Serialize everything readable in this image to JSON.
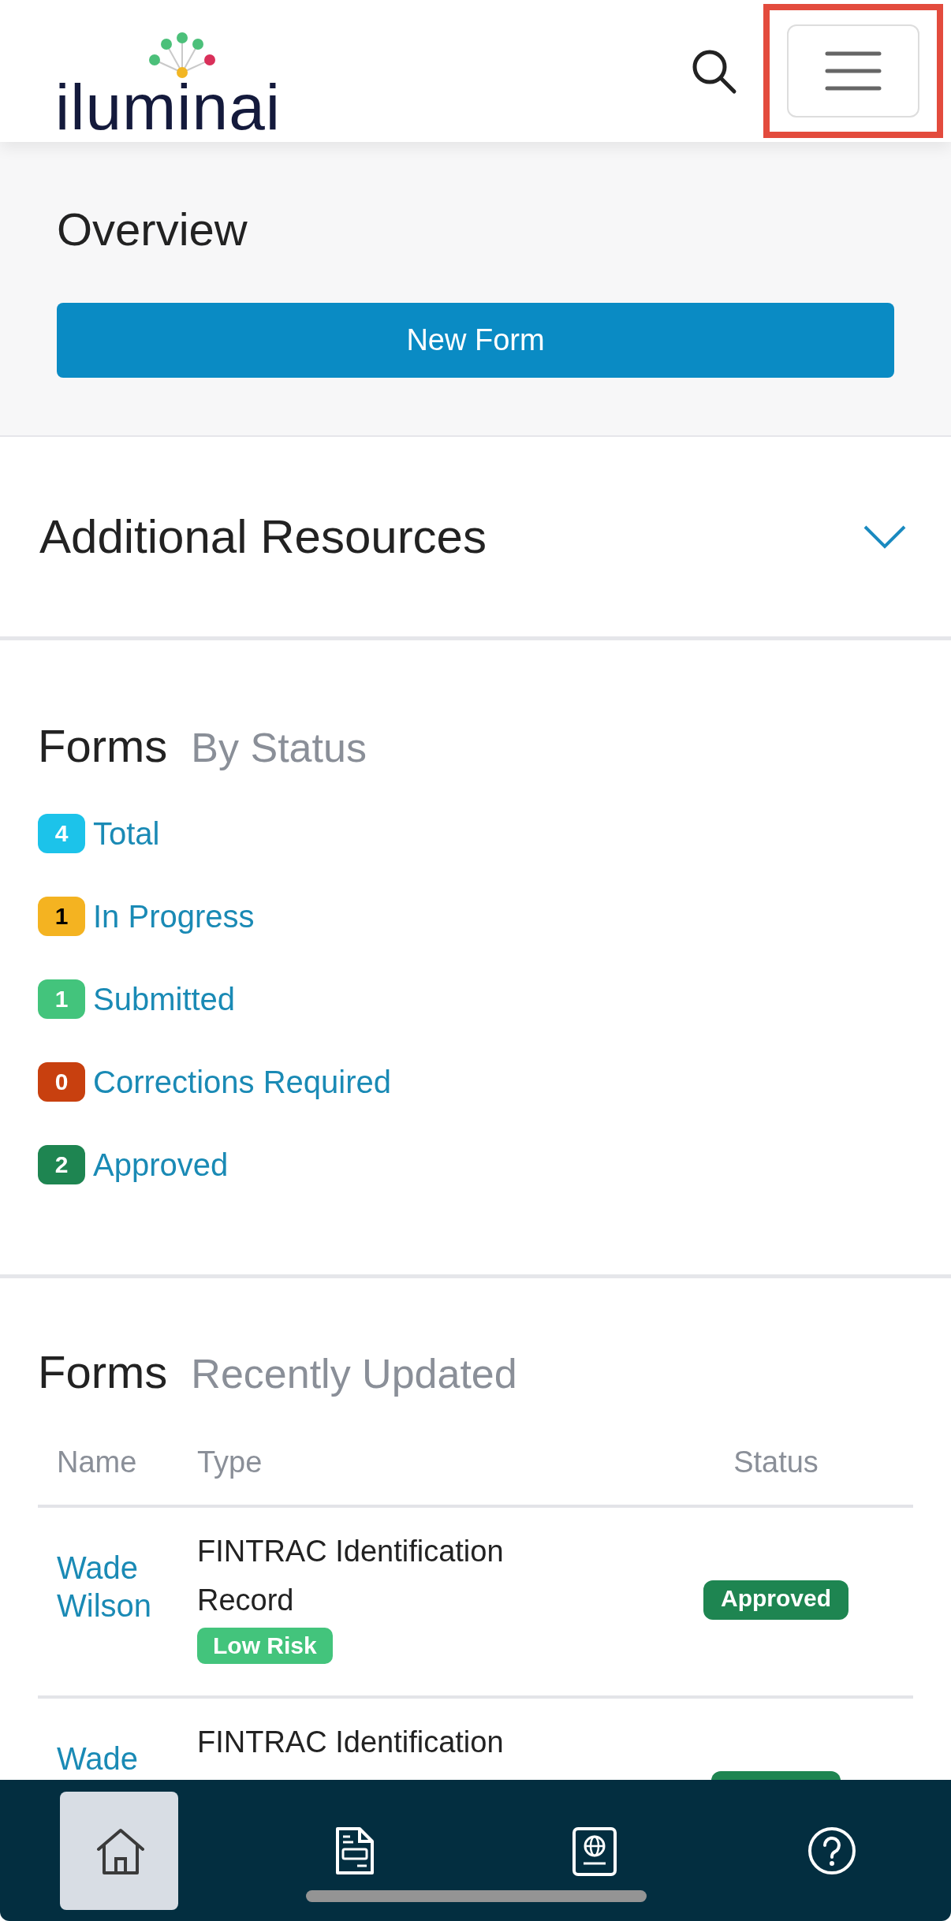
{
  "header": {
    "logo": "iluminai",
    "menu_highlighted": true
  },
  "overview": {
    "title": "Overview",
    "button": "New Form"
  },
  "resources": {
    "title": "Additional Resources",
    "expanded": false
  },
  "by_status": {
    "title": "Forms",
    "subtitle": "By Status",
    "items": [
      {
        "count": "4",
        "label": "Total",
        "color": "#1cc3ea"
      },
      {
        "count": "1",
        "label": "In Progress",
        "color": "#f4b321"
      },
      {
        "count": "1",
        "label": "Submitted",
        "color": "#43c47c"
      },
      {
        "count": "0",
        "label": "Corrections Required",
        "color": "#c8400f"
      },
      {
        "count": "2",
        "label": "Approved",
        "color": "#1e8551"
      }
    ]
  },
  "recent": {
    "title": "Forms",
    "subtitle": "Recently Updated",
    "columns": [
      "Name",
      "Type",
      "Status"
    ],
    "rows": [
      {
        "name": "Wade Wilson",
        "type": "FINTRAC Identification Record",
        "risk": "Low Risk",
        "status": "Approved",
        "color": "#1e8551"
      },
      {
        "name": "Wade",
        "type": "FINTRAC Identification",
        "color": "#1e8551"
      }
    ]
  },
  "bottom_nav": [
    {
      "kind": "home",
      "selected": true
    },
    {
      "kind": "document",
      "selected": false
    },
    {
      "kind": "passport",
      "selected": false
    },
    {
      "kind": "help",
      "selected": false
    }
  ]
}
